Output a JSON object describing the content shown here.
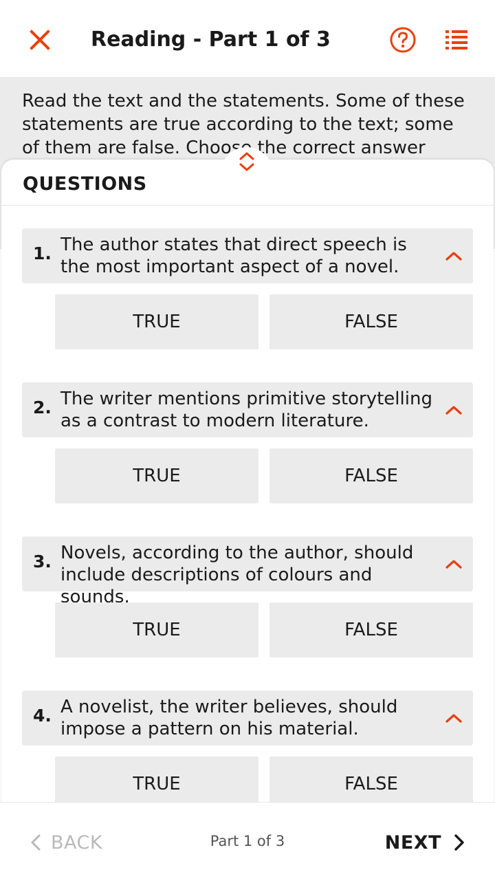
{
  "header": {
    "title": "Reading - Part 1 of 3",
    "close_icon": "close-icon",
    "help_icon": "help-icon",
    "list_icon": "list-icon"
  },
  "instructions": {
    "text": "Read the text and the statements. Some of these statements are true according to the text; some of them are false. Choose the correct answer TRUE or"
  },
  "questions_panel": {
    "title": "QUESTIONS",
    "items": [
      {
        "number": "1.",
        "text": "The author states that direct speech is the most important aspect of a novel.",
        "true_label": "TRUE",
        "false_label": "FALSE"
      },
      {
        "number": "2.",
        "text": "The writer mentions primitive storytelling as a contrast to modern literature.",
        "true_label": "TRUE",
        "false_label": "FALSE"
      },
      {
        "number": "3.",
        "text": "Novels, according to the author, should include descriptions of colours and sounds.",
        "true_label": "TRUE",
        "false_label": "FALSE"
      },
      {
        "number": "4.",
        "text": "A novelist, the writer believes, should impose a pattern on his material.",
        "true_label": "TRUE",
        "false_label": "FALSE"
      }
    ]
  },
  "footer": {
    "back_label": "BACK",
    "part_indicator": "Part 1 of 3",
    "next_label": "NEXT"
  },
  "colors": {
    "accent": "#e8400c",
    "panel_gray": "#ebebeb",
    "disabled": "#b9b9b9"
  }
}
